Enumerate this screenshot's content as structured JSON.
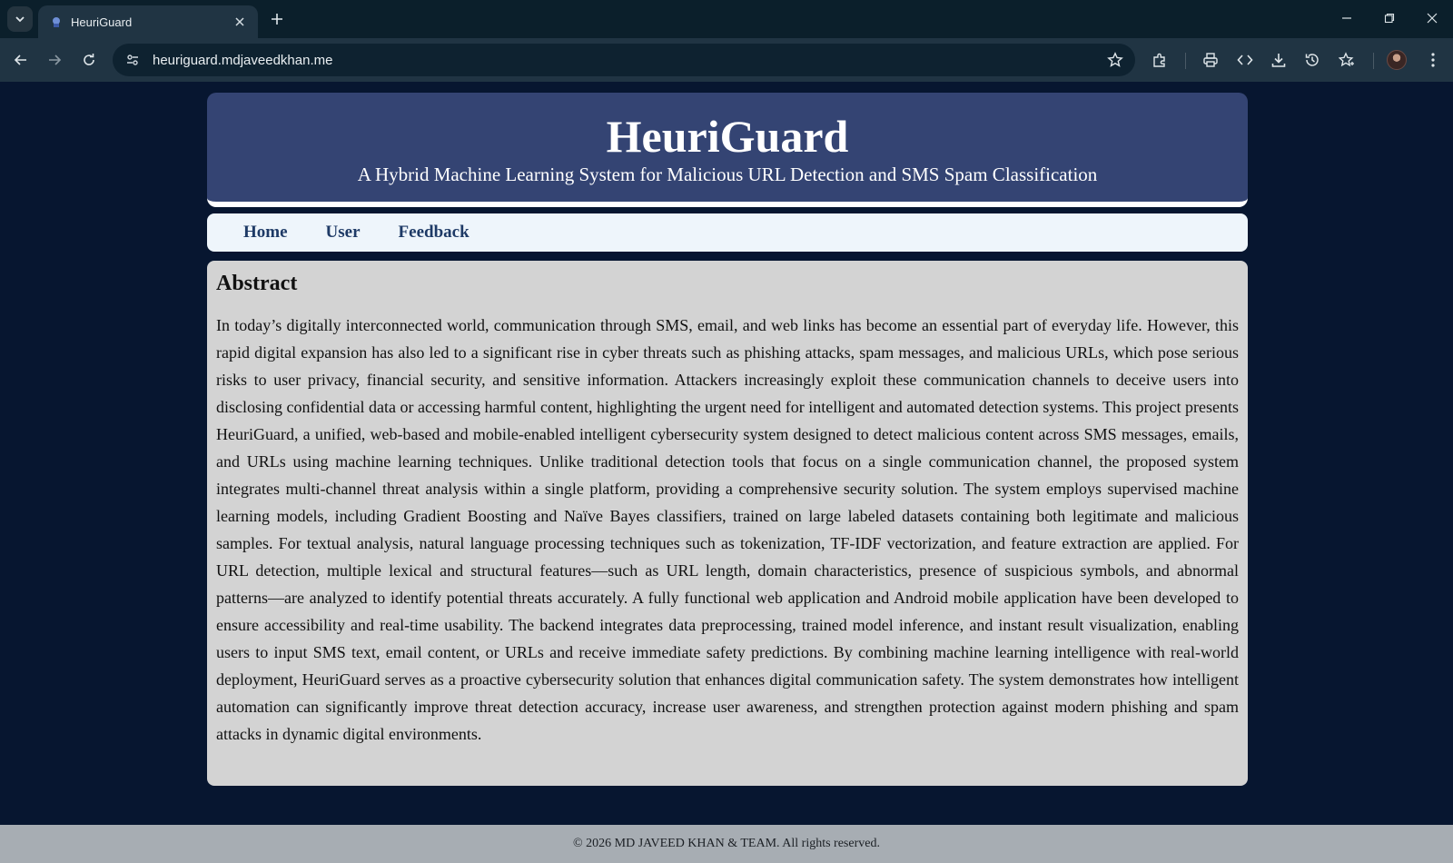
{
  "browser": {
    "tab_title": "HeuriGuard",
    "url": "heuriguard.mdjaveedkhan.me",
    "icons": [
      "tab-search-icon",
      "favicon-icon",
      "close-icon",
      "plus-icon",
      "minimize-icon",
      "restore-icon",
      "close-window-icon",
      "back-icon",
      "forward-icon",
      "reload-icon",
      "site-info-icon",
      "bookmark-star-icon",
      "extensions-icon",
      "print-icon",
      "code-icon",
      "download-icon",
      "history-icon",
      "favorites-icon",
      "profile-avatar",
      "menu-dots-icon"
    ]
  },
  "header": {
    "title": "HeuriGuard",
    "subtitle": "A Hybrid Machine Learning System for Malicious URL Detection and SMS Spam Classification"
  },
  "nav": {
    "items": [
      {
        "label": "Home"
      },
      {
        "label": "User"
      },
      {
        "label": "Feedback"
      }
    ]
  },
  "abstract": {
    "heading": "Abstract",
    "body": "In today’s digitally interconnected world, communication through SMS, email, and web links has become an essential part of everyday life. However, this rapid digital expansion has also led to a significant rise in cyber threats such as phishing attacks, spam messages, and malicious URLs, which pose serious risks to user privacy, financial security, and sensitive information. Attackers increasingly exploit these communication channels to deceive users into disclosing confidential data or accessing harmful content, highlighting the urgent need for intelligent and automated detection systems. This project presents HeuriGuard, a unified, web-based and mobile-enabled intelligent cybersecurity system designed to detect malicious content across SMS messages, emails, and URLs using machine learning techniques. Unlike traditional detection tools that focus on a single communication channel, the proposed system integrates multi-channel threat analysis within a single platform, providing a comprehensive security solution. The system employs supervised machine learning models, including Gradient Boosting and Naïve Bayes classifiers, trained on large labeled datasets containing both legitimate and malicious samples. For textual analysis, natural language processing techniques such as tokenization, TF-IDF vectorization, and feature extraction are applied. For URL detection, multiple lexical and structural features—such as URL length, domain characteristics, presence of suspicious symbols, and abnormal patterns—are analyzed to identify potential threats accurately. A fully functional web application and Android mobile application have been developed to ensure accessibility and real-time usability. The backend integrates data preprocessing, trained model inference, and instant result visualization, enabling users to input SMS text, email content, or URLs and receive immediate safety predictions. By combining machine learning intelligence with real-world deployment, HeuriGuard serves as a proactive cybersecurity solution that enhances digital communication safety. The system demonstrates how intelligent automation can significantly improve threat detection accuracy, increase user awareness, and strengthen protection against modern phishing and spam attacks in dynamic digital environments."
  },
  "footer": {
    "text": "© 2026 MD JAVEED KHAN & TEAM. All rights reserved."
  },
  "colors": {
    "page_bg": "#071630",
    "header_bg": "#344473",
    "nav_bg": "#eef5fb",
    "nav_link": "#1e3a66",
    "content_bg": "#d3d3d3",
    "footer_bg": "#a7adb3"
  }
}
